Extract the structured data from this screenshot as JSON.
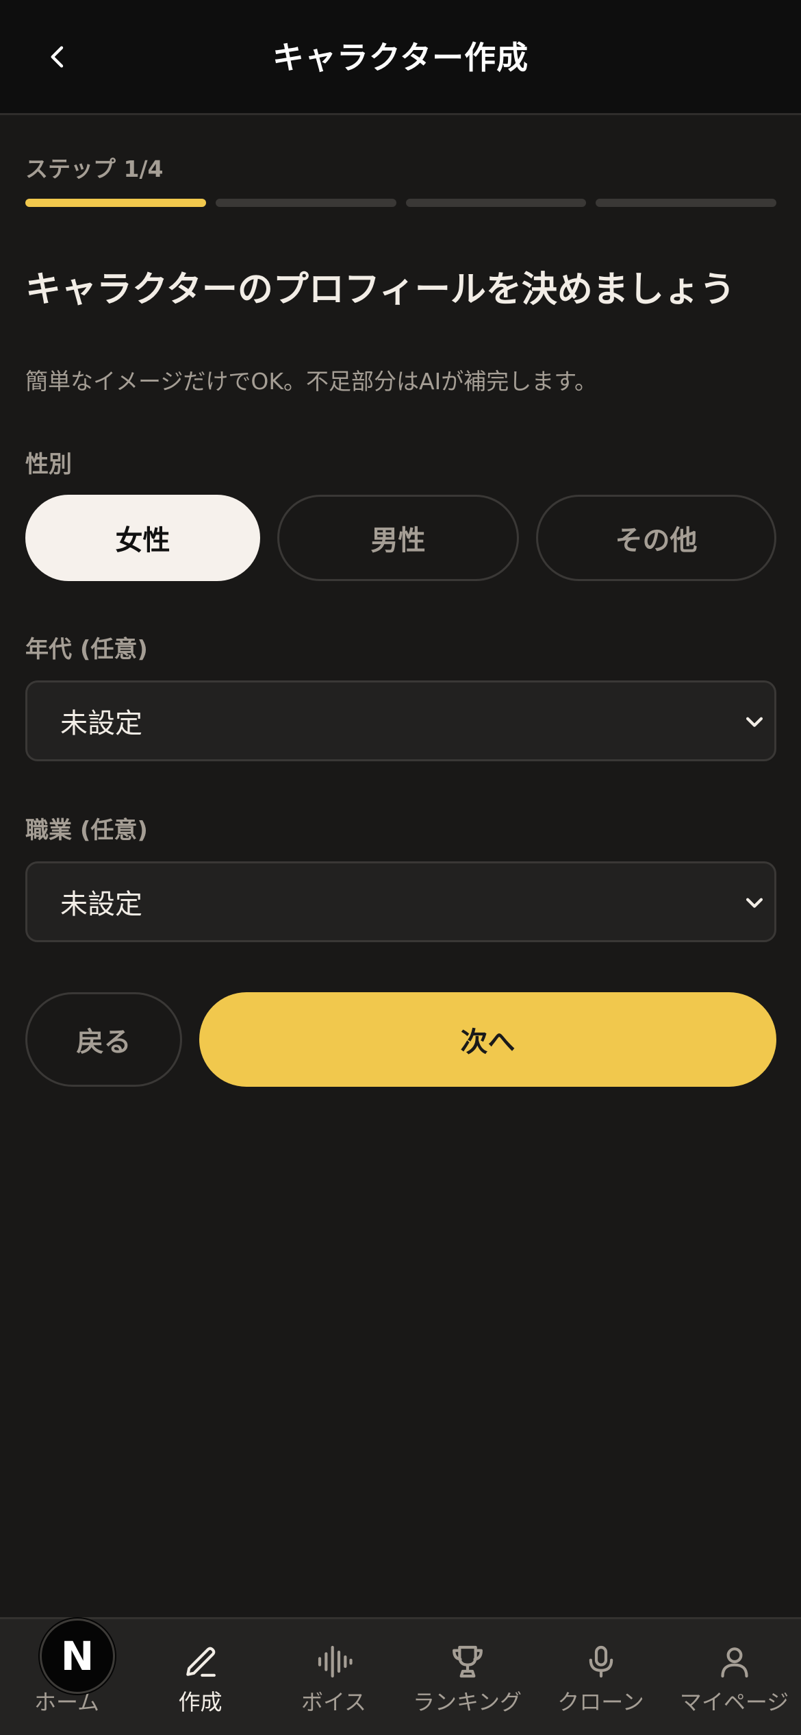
{
  "header": {
    "title": "キャラクター作成",
    "back_icon": "chevron-left-icon"
  },
  "step": {
    "label": "ステップ 1/4",
    "current": 1,
    "total": 4
  },
  "headline": "キャラクターのプロフィールを決めましょう",
  "subtext": "簡単なイメージだけでOK。不足部分はAIが補完します。",
  "gender": {
    "label": "性別",
    "options": [
      "女性",
      "男性",
      "その他"
    ],
    "selected": "女性"
  },
  "age": {
    "label": "年代 (任意)",
    "value": "未設定"
  },
  "occupation": {
    "label": "職業 (任意)",
    "value": "未設定"
  },
  "actions": {
    "back_label": "戻る",
    "next_label": "次へ"
  },
  "nav": {
    "items": [
      {
        "label": "ホーム",
        "icon": "home-icon"
      },
      {
        "label": "作成",
        "icon": "pencil-icon",
        "active": true
      },
      {
        "label": "ボイス",
        "icon": "waveform-icon"
      },
      {
        "label": "ランキング",
        "icon": "trophy-icon"
      },
      {
        "label": "クローン",
        "icon": "microphone-icon"
      },
      {
        "label": "マイページ",
        "icon": "user-icon"
      }
    ]
  },
  "fab": {
    "letter": "N"
  },
  "colors": {
    "accent": "#f1c84d",
    "background": "#191817",
    "header": "#0e0e0e"
  }
}
